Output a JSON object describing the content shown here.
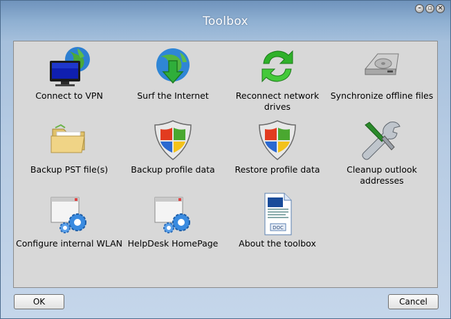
{
  "window": {
    "title": "Toolbox",
    "controls": [
      "minimize",
      "restore",
      "close"
    ]
  },
  "tools": [
    {
      "label": "Connect to VPN",
      "icon": "vpn-monitor-globe-icon"
    },
    {
      "label": "Surf the Internet",
      "icon": "globe-download-arrow-icon"
    },
    {
      "label": "Reconnect network drives",
      "icon": "green-refresh-arrows-icon"
    },
    {
      "label": "Synchronize offline files",
      "icon": "hard-drive-icon"
    },
    {
      "label": "Backup PST file(s)",
      "icon": "open-folder-icon"
    },
    {
      "label": "Backup profile data",
      "icon": "windows-shield-icon"
    },
    {
      "label": "Restore profile data",
      "icon": "windows-shield-icon"
    },
    {
      "label": "Cleanup outlook addresses",
      "icon": "screwdriver-wrench-icon"
    },
    {
      "label": "Configure internal WLAN",
      "icon": "window-gears-icon"
    },
    {
      "label": "HelpDesk HomePage",
      "icon": "window-gears-icon"
    },
    {
      "label": "About the toolbox",
      "icon": "doc-file-icon"
    }
  ],
  "footer": {
    "ok_label": "OK",
    "cancel_label": "Cancel"
  },
  "colors": {
    "title_bar_top": "#6f93bc",
    "window_bottom": "#c5d6ea",
    "panel_background": "#d8d8d8"
  }
}
